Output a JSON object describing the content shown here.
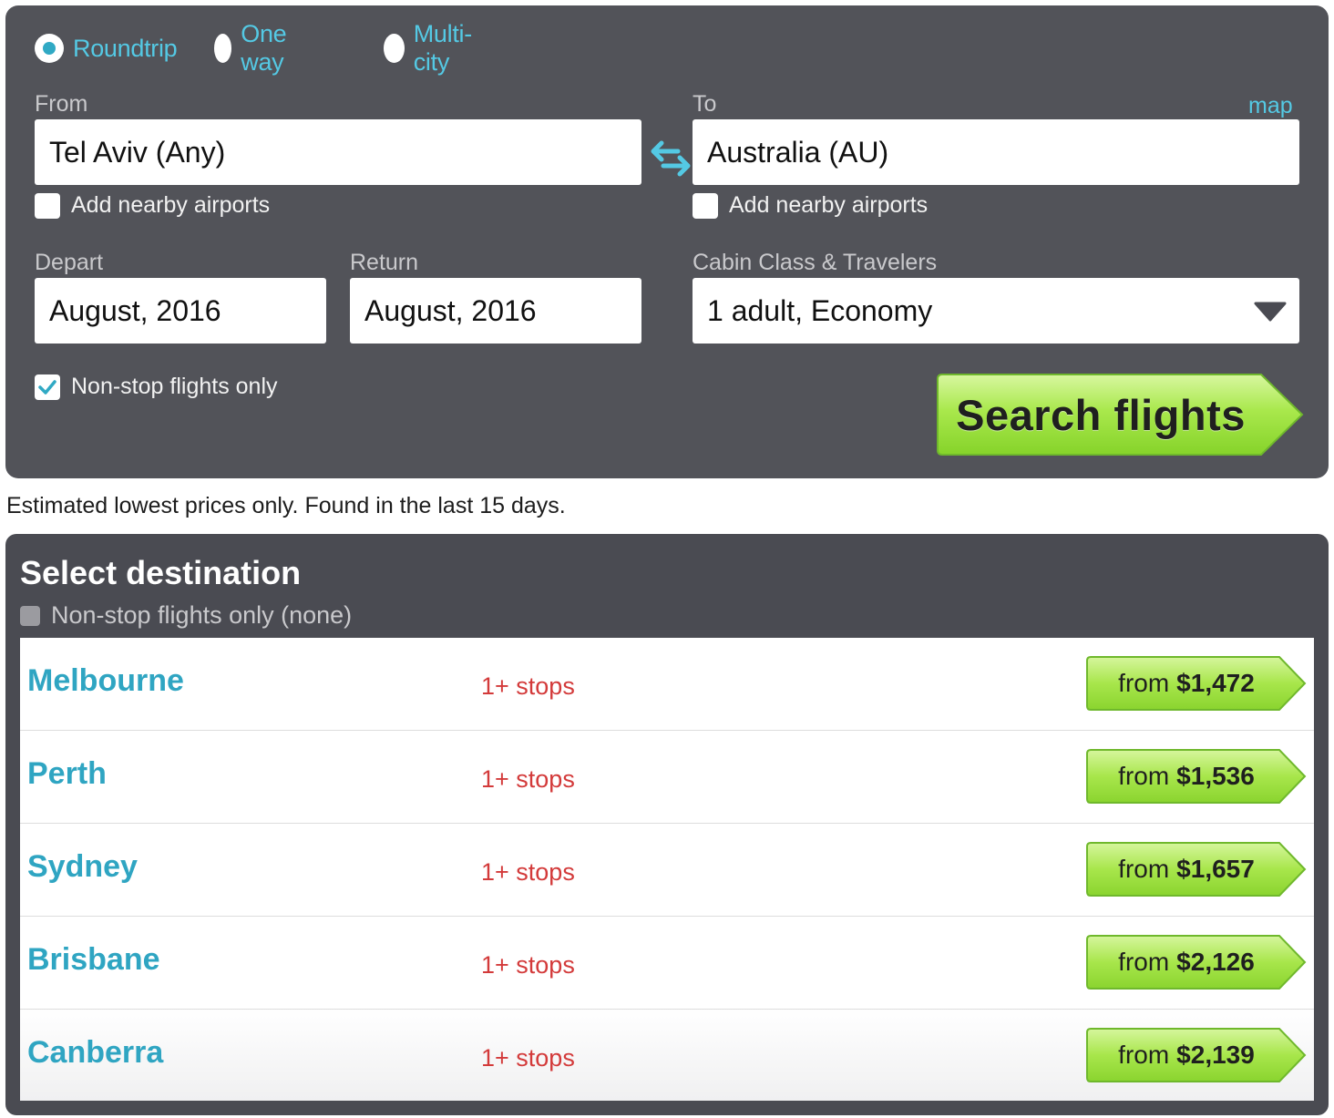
{
  "trip_type": {
    "options": [
      {
        "label": "Roundtrip",
        "selected": true
      },
      {
        "label": "One way",
        "selected": false
      },
      {
        "label": "Multi-city",
        "selected": false
      }
    ]
  },
  "from": {
    "label": "From",
    "value": "Tel Aviv (Any)",
    "nearby_label": "Add nearby airports",
    "nearby_checked": false
  },
  "to": {
    "label": "To",
    "map_link": "map",
    "value": "Australia (AU)",
    "nearby_label": "Add nearby airports",
    "nearby_checked": false
  },
  "depart": {
    "label": "Depart",
    "value": "August, 2016"
  },
  "return": {
    "label": "Return",
    "value": "August, 2016"
  },
  "cabin": {
    "label": "Cabin Class & Travelers",
    "value": "1 adult, Economy"
  },
  "nonstop": {
    "label": "Non-stop flights only",
    "checked": true
  },
  "search_button": "Search flights",
  "note": "Estimated lowest prices only. Found in the last 15 days.",
  "destinations": {
    "title": "Select destination",
    "filter_label": "Non-stop flights only (none)",
    "items": [
      {
        "name": "Melbourne",
        "stops": "1+ stops",
        "from_label": "from",
        "price": "$1,472"
      },
      {
        "name": "Perth",
        "stops": "1+ stops",
        "from_label": "from",
        "price": "$1,536"
      },
      {
        "name": "Sydney",
        "stops": "1+ stops",
        "from_label": "from",
        "price": "$1,657"
      },
      {
        "name": "Brisbane",
        "stops": "1+ stops",
        "from_label": "from",
        "price": "$2,126"
      },
      {
        "name": "Canberra",
        "stops": "1+ stops",
        "from_label": "from",
        "price": "$2,139"
      }
    ]
  },
  "colors": {
    "panel_bg": "#525359",
    "accent_blue": "#54c9e4",
    "link_blue": "#2fa5c2",
    "stops_red": "#d33a3a",
    "button_green": "#9ee04a"
  },
  "icons": {
    "swap": "swap-arrows-icon",
    "dropdown": "triangle-down-icon",
    "checkmark": "checkmark-icon"
  }
}
